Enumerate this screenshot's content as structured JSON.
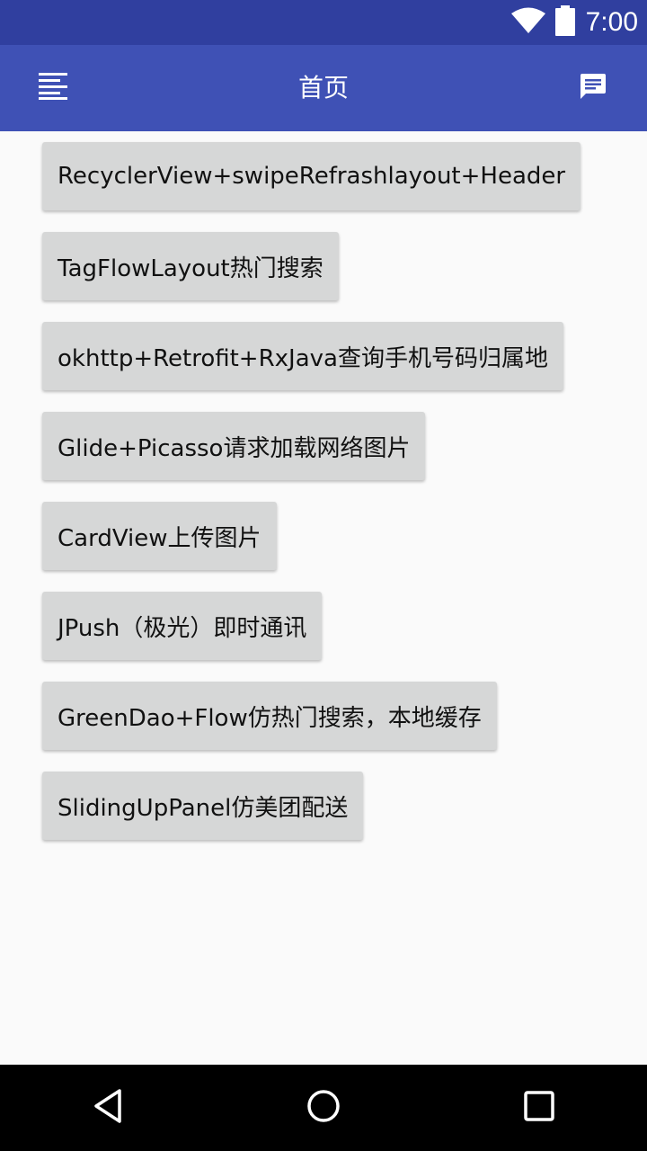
{
  "status_bar": {
    "time": "7:00",
    "icons": [
      "wifi-icon",
      "battery-icon"
    ]
  },
  "toolbar": {
    "title": "首页",
    "left_icon": "menu-icon",
    "right_icon": "message-icon"
  },
  "buttons": [
    {
      "label": "RecyclerView+swipeRefrashlayout+Header"
    },
    {
      "label": "TagFlowLayout热门搜索"
    },
    {
      "label": "okhttp+Retrofit+RxJava查询手机号码归属地"
    },
    {
      "label": "Glide+Picasso请求加载网络图片"
    },
    {
      "label": "CardView上传图片"
    },
    {
      "label": "JPush（极光）即时通讯"
    },
    {
      "label": "GreenDao+Flow仿热门搜索，本地缓存"
    },
    {
      "label": "SlidingUpPanel仿美团配送"
    }
  ],
  "nav_bar": {
    "icons": [
      "back-icon",
      "home-icon",
      "recents-icon"
    ]
  },
  "colors": {
    "status_bar": "#303f9f",
    "toolbar": "#3f51b5",
    "background": "#fafafa",
    "button": "#d6d7d7"
  }
}
